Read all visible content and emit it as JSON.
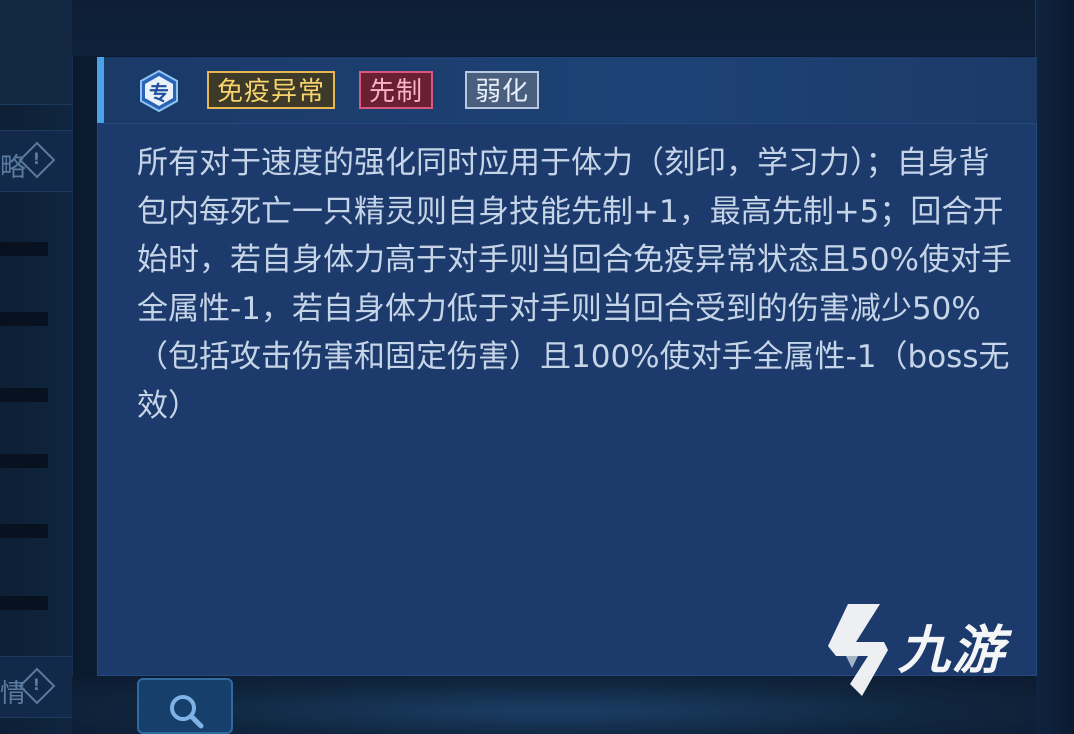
{
  "background": {
    "left_labels": [
      "略",
      "情"
    ],
    "icons": [
      "warning-icon",
      "search-icon"
    ]
  },
  "tooltip": {
    "type_icon": {
      "name": "exclusive-skill-icon",
      "text": "专"
    },
    "tags": [
      {
        "label": "免疫异常",
        "color": "#e7b84f"
      },
      {
        "label": "先制",
        "color": "#d8577b"
      },
      {
        "label": "弱化",
        "color": "#b9c8de"
      }
    ],
    "description": "所有对于速度的强化同时应用于体力（刻印，学习力）；自身背包内每死亡一只精灵则自身技能先制+1，最高先制+5；回合开始时，若自身体力高于对手则当回合免疫异常状态且50%使对手全属性-1，若自身体力低于对手则当回合受到的伤害减少50%（包括攻击伤害和固定伤害）且100%使对手全属性-1（boss无效）",
    "accent_color": "#4aa3e6",
    "background_color": "#1c3b6c"
  },
  "watermark": {
    "text": "九游",
    "logo": "jiuyou-logo-icon"
  }
}
